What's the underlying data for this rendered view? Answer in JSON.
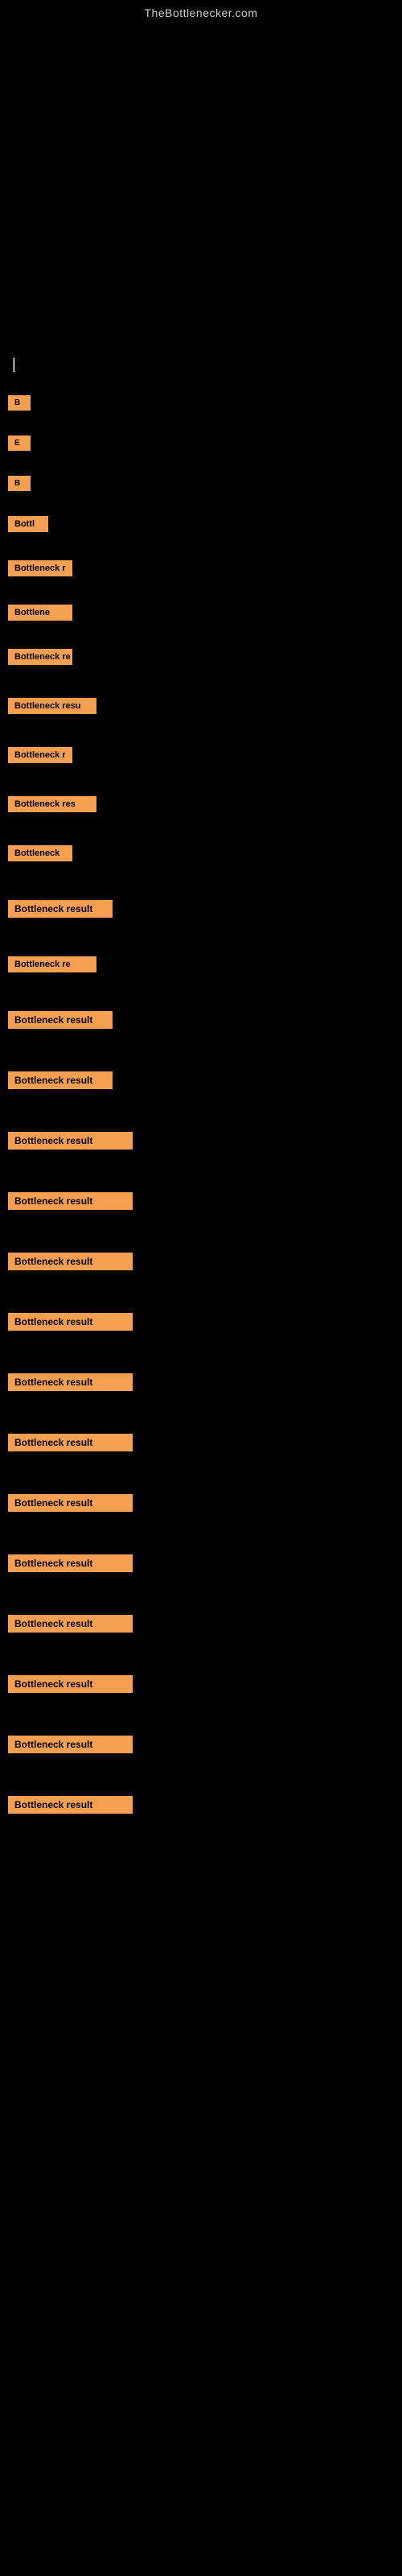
{
  "site": {
    "title": "TheBottlenecker.com"
  },
  "cursor": "|",
  "results": [
    {
      "id": 1,
      "label": "B",
      "size": "xs"
    },
    {
      "id": 2,
      "label": "E",
      "size": "xs"
    },
    {
      "id": 3,
      "label": "B",
      "size": "xs"
    },
    {
      "id": 4,
      "label": "Bottl",
      "size": "sm"
    },
    {
      "id": 5,
      "label": "Bottleneck r",
      "size": "md"
    },
    {
      "id": 6,
      "label": "Bottlene",
      "size": "md"
    },
    {
      "id": 7,
      "label": "Bottleneck re",
      "size": "md"
    },
    {
      "id": 8,
      "label": "Bottleneck resu",
      "size": "lg"
    },
    {
      "id": 9,
      "label": "Bottleneck r",
      "size": "md"
    },
    {
      "id": 10,
      "label": "Bottleneck res",
      "size": "lg"
    },
    {
      "id": 11,
      "label": "Bottleneck",
      "size": "md"
    },
    {
      "id": 12,
      "label": "Bottleneck result",
      "size": "xl"
    },
    {
      "id": 13,
      "label": "Bottleneck re",
      "size": "lg"
    },
    {
      "id": 14,
      "label": "Bottleneck result",
      "size": "xl"
    },
    {
      "id": 15,
      "label": "Bottleneck result",
      "size": "xl"
    },
    {
      "id": 16,
      "label": "Bottleneck result",
      "size": "full"
    },
    {
      "id": 17,
      "label": "Bottleneck result",
      "size": "full"
    },
    {
      "id": 18,
      "label": "Bottleneck result",
      "size": "full"
    },
    {
      "id": 19,
      "label": "Bottleneck result",
      "size": "full"
    },
    {
      "id": 20,
      "label": "Bottleneck result",
      "size": "full"
    },
    {
      "id": 21,
      "label": "Bottleneck result",
      "size": "full"
    },
    {
      "id": 22,
      "label": "Bottleneck result",
      "size": "full"
    },
    {
      "id": 23,
      "label": "Bottleneck result",
      "size": "full"
    },
    {
      "id": 24,
      "label": "Bottleneck result",
      "size": "full"
    },
    {
      "id": 25,
      "label": "Bottleneck result",
      "size": "full"
    },
    {
      "id": 26,
      "label": "Bottleneck result",
      "size": "full"
    },
    {
      "id": 27,
      "label": "Bottleneck result",
      "size": "full"
    }
  ]
}
